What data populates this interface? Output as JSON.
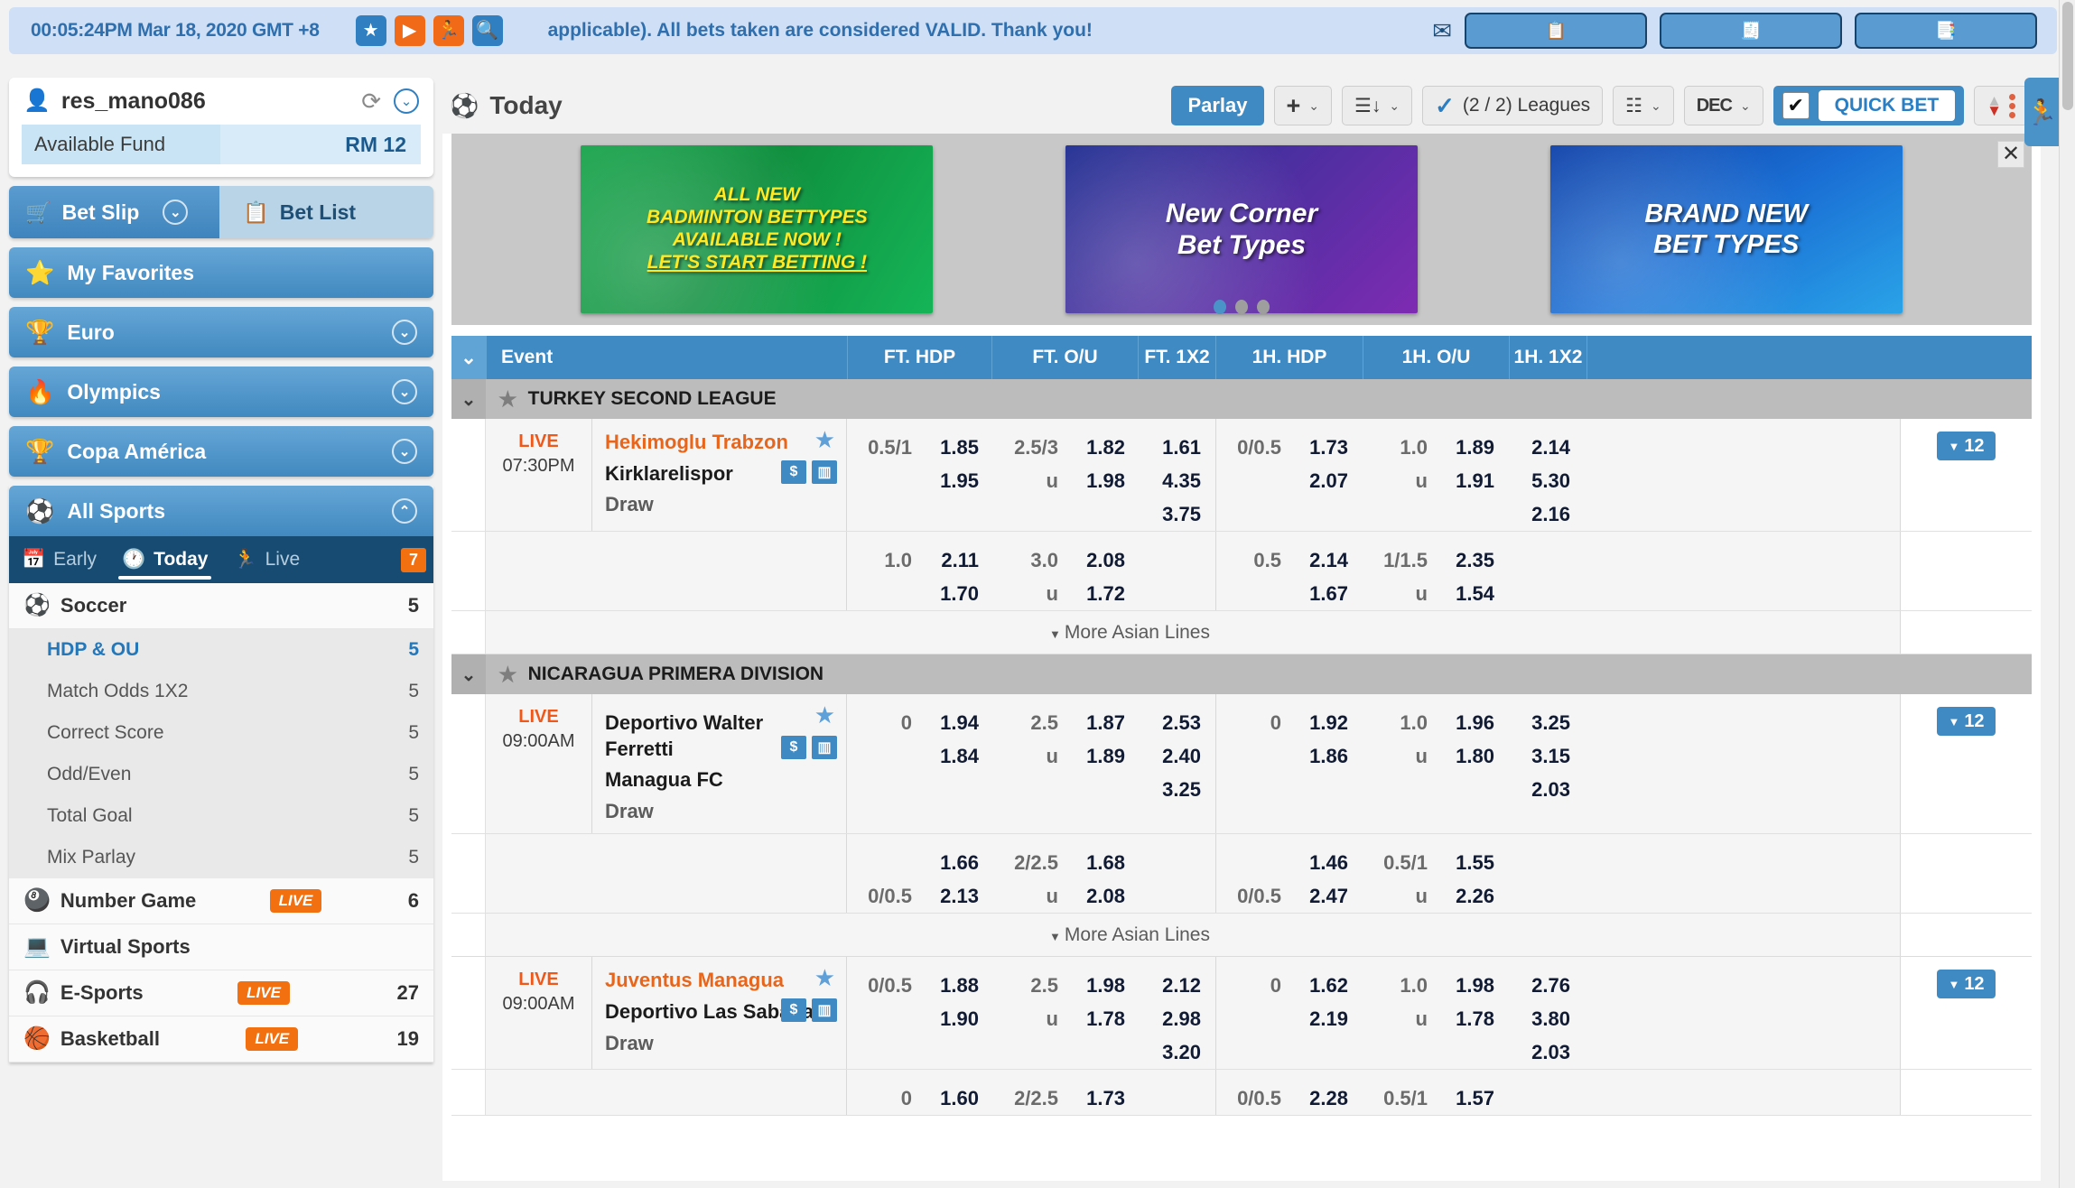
{
  "topbar": {
    "clock": "00:05:24PM Mar 18, 2020 GMT +8",
    "marquee": "applicable). All bets taken are considered VALID. Thank you!",
    "icons": [
      "star-icon",
      "play-icon",
      "running-icon",
      "search-icon"
    ],
    "mail_icon": "mail-icon",
    "buttons": [
      {
        "name": "statement-button",
        "icon": "clipboard-icon"
      },
      {
        "name": "cash-statement-button",
        "icon": "money-receipt-icon"
      },
      {
        "name": "results-button",
        "icon": "results-icon"
      }
    ]
  },
  "account": {
    "username": "res_mano086",
    "fund_label": "Available Fund",
    "fund_value": "RM 12",
    "refresh_icon": "refresh-icon",
    "expand_icon": "chevron-down-icon"
  },
  "bet_tabs": {
    "bet_slip": "Bet Slip",
    "bet_list": "Bet List"
  },
  "sidebar": {
    "nav": [
      {
        "label": "My Favorites",
        "icon": "star-icon",
        "chevron": false
      },
      {
        "label": "Euro",
        "icon": "trophy-icon",
        "chevron": true
      },
      {
        "label": "Olympics",
        "icon": "torch-icon",
        "chevron": true
      },
      {
        "label": "Copa América",
        "icon": "trophy-icon",
        "chevron": true
      },
      {
        "label": "All Sports",
        "icon": "sports-balls-icon",
        "chevron": true
      }
    ],
    "subtabs": [
      {
        "label": "Early",
        "icon": "calendar-icon",
        "active": false
      },
      {
        "label": "Today",
        "icon": "clock-icon",
        "active": true
      },
      {
        "label": "Live",
        "icon": "running-icon",
        "active": false
      }
    ],
    "live_badge": "7",
    "sports": [
      {
        "label": "Soccer",
        "icon": "soccer-ball-icon",
        "count": "5",
        "live": false
      },
      {
        "label": "Number Game",
        "icon": "number-balls-icon",
        "count": "6",
        "live": true,
        "live_label": "LIVE"
      },
      {
        "label": "Virtual Sports",
        "icon": "virtual-sports-icon",
        "count": "",
        "live": false
      },
      {
        "label": "E-Sports",
        "icon": "headset-icon",
        "count": "27",
        "live": true,
        "live_label": "LIVE"
      },
      {
        "label": "Basketball",
        "icon": "basketball-icon",
        "count": "19",
        "live": true,
        "live_label": "LIVE"
      }
    ],
    "soccer_markets": [
      {
        "label": "HDP & OU",
        "count": "5",
        "selected": true
      },
      {
        "label": "Match Odds 1X2",
        "count": "5",
        "selected": false
      },
      {
        "label": "Correct Score",
        "count": "5",
        "selected": false
      },
      {
        "label": "Odd/Even",
        "count": "5",
        "selected": false
      },
      {
        "label": "Total Goal",
        "count": "5",
        "selected": false
      },
      {
        "label": "Mix Parlay",
        "count": "5",
        "selected": false
      }
    ]
  },
  "toolbar": {
    "title": "Today",
    "parlay": "Parlay",
    "add_label": "+",
    "sort_label": "sort-icon",
    "leagues_label": "(2 / 2) Leagues",
    "list_label": "list-icon",
    "odds_format": "DEC",
    "quick_bet": "QUICK BET",
    "arrows_label": "sort-arrows-icon"
  },
  "carousel": {
    "close": "✕",
    "banners": [
      {
        "name": "banner-badminton",
        "text": "ALL NEW\nBADMINTON BETTYPES\nAVAILABLE NOW !\nLET'S START BETTING !"
      },
      {
        "name": "banner-corner",
        "text": "New Corner\nBet Types"
      },
      {
        "name": "banner-brandnew",
        "text": "BRAND NEW\nBET TYPES"
      }
    ],
    "dots": 3,
    "active_dot": 0
  },
  "table": {
    "headers": {
      "event": "Event",
      "ft_hdp": "FT. HDP",
      "ft_ou": "FT. O/U",
      "ft_1x2": "FT. 1X2",
      "h1_hdp": "1H. HDP",
      "h1_ou": "1H. O/U",
      "h1_1x2": "1H. 1X2"
    },
    "more_asian_lines": "More Asian Lines",
    "leagues": [
      {
        "name": "TURKEY SECOND LEAGUE",
        "matches": [
          {
            "status": "LIVE",
            "time": "07:30PM",
            "home": "Hekimoglu Trabzon",
            "away": "Kirklarelispor",
            "draw": "Draw",
            "chip": "12",
            "main": {
              "ft_hdp": {
                "line": "0.5/1",
                "odds": [
                  "1.85",
                  "1.95"
                ]
              },
              "ft_ou": {
                "line_over": "2.5/3",
                "line_under": "u",
                "odds": [
                  "1.82",
                  "1.98"
                ]
              },
              "ft_1x2": [
                "1.61",
                "4.35",
                "3.75"
              ],
              "h1_hdp": {
                "line": "0/0.5",
                "odds": [
                  "1.73",
                  "2.07"
                ]
              },
              "h1_ou": {
                "line_over": "1.0",
                "line_under": "u",
                "odds": [
                  "1.89",
                  "1.91"
                ]
              },
              "h1_1x2": [
                "2.14",
                "5.30",
                "2.16"
              ]
            },
            "alt": {
              "ft_hdp": {
                "line_top": "1.0",
                "line_bot": "",
                "odds": [
                  "2.11",
                  "1.70"
                ]
              },
              "ft_ou": {
                "line_over": "3.0",
                "line_under": "u",
                "odds": [
                  "2.08",
                  "1.72"
                ]
              },
              "h1_hdp": {
                "line_top": "0.5",
                "line_bot": "",
                "odds": [
                  "2.14",
                  "1.67"
                ]
              },
              "h1_ou": {
                "line_over": "1/1.5",
                "line_under": "u",
                "odds": [
                  "2.35",
                  "1.54"
                ]
              }
            },
            "has_more": true
          }
        ]
      },
      {
        "name": "NICARAGUA PRIMERA DIVISION",
        "matches": [
          {
            "status": "LIVE",
            "time": "09:00AM",
            "home": "Deportivo Walter Ferretti",
            "away": "Managua FC",
            "draw": "Draw",
            "chip": "12",
            "main": {
              "ft_hdp": {
                "line": "0",
                "odds": [
                  "1.94",
                  "1.84"
                ]
              },
              "ft_ou": {
                "line_over": "2.5",
                "line_under": "u",
                "odds": [
                  "1.87",
                  "1.89"
                ]
              },
              "ft_1x2": [
                "2.53",
                "2.40",
                "3.25"
              ],
              "h1_hdp": {
                "line": "0",
                "odds": [
                  "1.92",
                  "1.86"
                ]
              },
              "h1_ou": {
                "line_over": "1.0",
                "line_under": "u",
                "odds": [
                  "1.96",
                  "1.80"
                ]
              },
              "h1_1x2": [
                "3.25",
                "3.15",
                "2.03"
              ]
            },
            "alt": {
              "ft_hdp": {
                "line_top": "",
                "line_bot": "0/0.5",
                "odds": [
                  "1.66",
                  "2.13"
                ]
              },
              "ft_ou": {
                "line_over": "2/2.5",
                "line_under": "u",
                "odds": [
                  "1.68",
                  "2.08"
                ]
              },
              "h1_hdp": {
                "line_top": "",
                "line_bot": "0/0.5",
                "odds": [
                  "1.46",
                  "2.47"
                ]
              },
              "h1_ou": {
                "line_over": "0.5/1",
                "line_under": "u",
                "odds": [
                  "1.55",
                  "2.26"
                ]
              }
            },
            "has_more": true
          },
          {
            "status": "LIVE",
            "time": "09:00AM",
            "home": "Juventus Managua",
            "away": "Deportivo Las Sabanas",
            "draw": "Draw",
            "chip": "12",
            "main": {
              "ft_hdp": {
                "line": "0/0.5",
                "odds": [
                  "1.88",
                  "1.90"
                ]
              },
              "ft_ou": {
                "line_over": "2.5",
                "line_under": "u",
                "odds": [
                  "1.98",
                  "1.78"
                ]
              },
              "ft_1x2": [
                "2.12",
                "2.98",
                "3.20"
              ],
              "h1_hdp": {
                "line": "0",
                "odds": [
                  "1.62",
                  "2.19"
                ]
              },
              "h1_ou": {
                "line_over": "1.0",
                "line_under": "u",
                "odds": [
                  "1.98",
                  "1.78"
                ]
              },
              "h1_1x2": [
                "2.76",
                "3.80",
                "2.03"
              ]
            },
            "alt": {
              "ft_hdp": {
                "line_top": "0",
                "line_bot": "",
                "odds": [
                  "1.60",
                  ""
                ]
              },
              "ft_ou": {
                "line_over": "2/2.5",
                "line_under": "",
                "odds": [
                  "1.73",
                  ""
                ]
              },
              "h1_hdp": {
                "line_top": "0/0.5",
                "line_bot": "",
                "odds": [
                  "2.28",
                  ""
                ]
              },
              "h1_ou": {
                "line_over": "0.5/1",
                "line_under": "",
                "odds": [
                  "1.57",
                  ""
                ]
              }
            },
            "has_more": false
          }
        ]
      }
    ]
  }
}
